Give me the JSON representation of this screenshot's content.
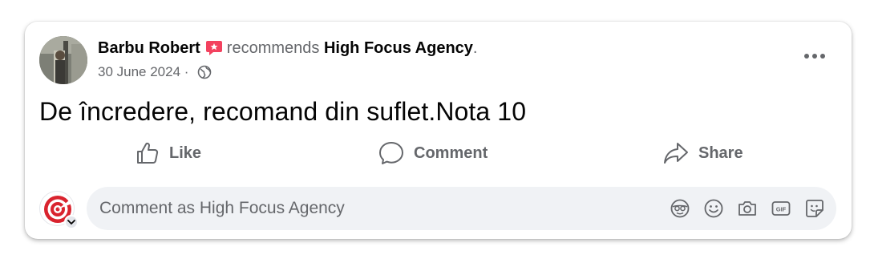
{
  "post": {
    "author": "Barbu Robert",
    "verb": "recommends",
    "page_name": "High Focus Agency",
    "punct": ".",
    "date": "30 June 2024",
    "date_sep": " · ",
    "text": "De încredere, recomand din suflet.Nota 10",
    "badge_icon": "recommend-badge-icon",
    "audience_icon": "globe-icon",
    "menu_icon": "more-options-icon"
  },
  "actions": {
    "like_label": "Like",
    "comment_label": "Comment",
    "share_label": "Share"
  },
  "composer": {
    "placeholder": "Comment as High Focus Agency",
    "value": "",
    "tools": [
      "avatar-sticker-icon",
      "emoji-icon",
      "camera-icon",
      "gif-icon",
      "sticker-icon"
    ]
  },
  "colors": {
    "text_primary": "#050505",
    "text_secondary": "#65676b",
    "composer_bg": "#f0f2f5",
    "badge": "#f3425f"
  }
}
